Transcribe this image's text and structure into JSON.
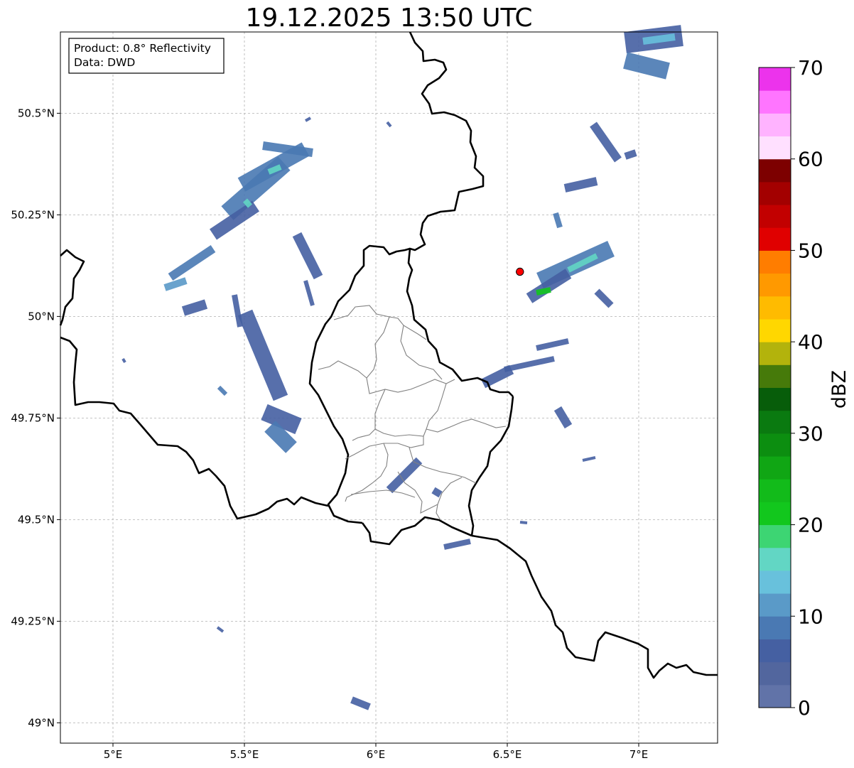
{
  "title": "19.12.2025 13:50 UTC",
  "info_box": {
    "line1": "Product: 0.8° Reflectivity",
    "line2": "Data: DWD"
  },
  "map": {
    "lon_range": [
      4.8,
      7.3
    ],
    "lat_range": [
      48.95,
      50.7
    ],
    "x_ticks": [
      {
        "value": 5.0,
        "label": "5°E"
      },
      {
        "value": 5.5,
        "label": "5.5°E"
      },
      {
        "value": 6.0,
        "label": "6°E"
      },
      {
        "value": 6.5,
        "label": "6.5°E"
      },
      {
        "value": 7.0,
        "label": "7°E"
      }
    ],
    "y_ticks": [
      {
        "value": 49.0,
        "label": "49°N"
      },
      {
        "value": 49.25,
        "label": "49.25°N"
      },
      {
        "value": 49.5,
        "label": "49.5°N"
      },
      {
        "value": 49.75,
        "label": "49.75°N"
      },
      {
        "value": 50.0,
        "label": "50°N"
      },
      {
        "value": 50.25,
        "label": "50.25°N"
      },
      {
        "value": 50.5,
        "label": "50.5°N"
      }
    ],
    "grid": true,
    "radar_marker": {
      "lon": 6.548,
      "lat": 50.11,
      "color": "#ff0000"
    }
  },
  "colorbar": {
    "label": "dBZ",
    "min": 0,
    "max": 70,
    "step": 2.5,
    "tick_labels": [
      "0",
      "10",
      "20",
      "30",
      "40",
      "50",
      "60",
      "70"
    ],
    "colors": [
      "#6173a8",
      "#52669e",
      "#4560a2",
      "#4a79b3",
      "#5a9ac8",
      "#68c1dc",
      "#62d6c4",
      "#3dd573",
      "#12c71d",
      "#12bb1a",
      "#10a614",
      "#0c8e10",
      "#0a7a10",
      "#075d0a",
      "#467a0a",
      "#b3b30c",
      "#ffd700",
      "#ffbb00",
      "#ff9900",
      "#ff7d00",
      "#e00000",
      "#c20000",
      "#a30000",
      "#7d0000",
      "#ffe0ff",
      "#ffb3ff",
      "#ff75ff",
      "#ec33ec"
    ]
  }
}
